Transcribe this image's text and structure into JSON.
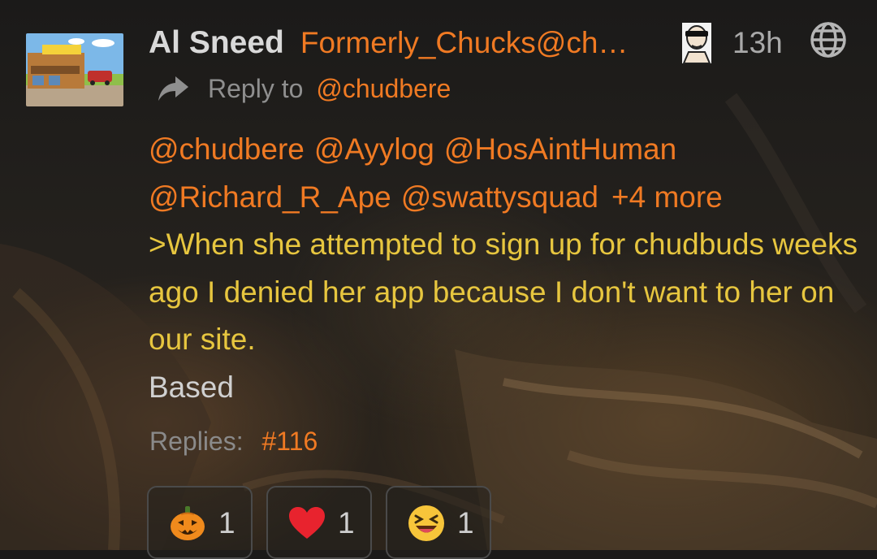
{
  "post": {
    "display_name": "Al Sneed",
    "handle": "Formerly_Chucks@ch…",
    "time": "13h",
    "reply_prefix": "Reply to",
    "reply_target": "@chudbere",
    "mentions": [
      "@chudbere",
      "@Ayylog",
      "@HosAintHuman",
      "@Richard_R_Ape",
      "@swattysquad"
    ],
    "more_mentions": "+4 more",
    "greentext": ">When she attempted to sign up for chudbuds weeks ago I denied her app because I don't want to her on our site.",
    "body": "Based",
    "replies_label": "Replies:",
    "replies_ref": "#116"
  },
  "icons": {
    "reply": "reply-arrow-icon",
    "visibility": "globe-icon"
  },
  "reactions": [
    {
      "emoji": "jack-o-lantern",
      "count": "1"
    },
    {
      "emoji": "red-heart",
      "count": "1"
    },
    {
      "emoji": "grinning-squinting-face",
      "count": "1"
    }
  ],
  "colors": {
    "accent": "#f07a23",
    "greentext": "#e7c63f",
    "name": "#d9d9d9",
    "muted": "#8f8f8f"
  }
}
